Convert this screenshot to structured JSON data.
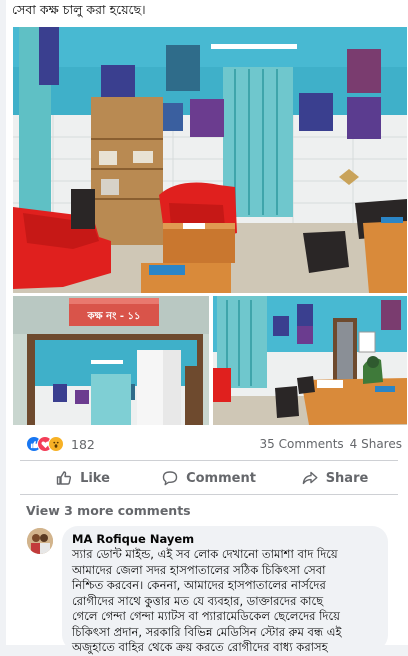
{
  "post": {
    "text_line": "সেবা কক্ষ চালু করা হয়েছে।"
  },
  "photos": {
    "door_sign": "কক্ষ নং - ১১"
  },
  "reactions": {
    "count": "182",
    "types": [
      "like-icon",
      "love-icon",
      "wow-icon"
    ],
    "colors": {
      "like": "#1877f2",
      "love": "#f33e58",
      "wow": "#f7b125"
    }
  },
  "stats": {
    "comments": "35 Comments",
    "shares": "4 Shares"
  },
  "actions": {
    "like": "Like",
    "comment": "Comment",
    "share": "Share"
  },
  "comments": {
    "view_more": "View 3 more comments",
    "items": [
      {
        "author": "MA Rofique Nayem",
        "lines": [
          "স্যার ডোন্ট মাইন্ড, এই সব লোক দেখানো তামাশা বাদ দিয়ে",
          "আমাদের জেলা সদর হাসপাতালের সঠিক চিকিৎসা সেবা",
          "নিশ্চিত করবেন। কেননা, আমাদের হাসপাতালের নার্সদের",
          "রোগীদের সাথে কুত্তার মত যে ব্যবহার, ডাক্তারদের কাছে",
          "গেলে গেন্দা গেন্দা ম্যাটস বা প্যারামেডিকেল ছেলেদের দিয়ে",
          "চিকিৎসা প্রদান, সরকারি বিভিন্ন মেডিসিন স্টোর রুম বন্ধ এই",
          "অজুহাতে বাহির থেকে ক্রয় করতে রোগীদের বাধ্য করাসহ"
        ]
      }
    ]
  }
}
